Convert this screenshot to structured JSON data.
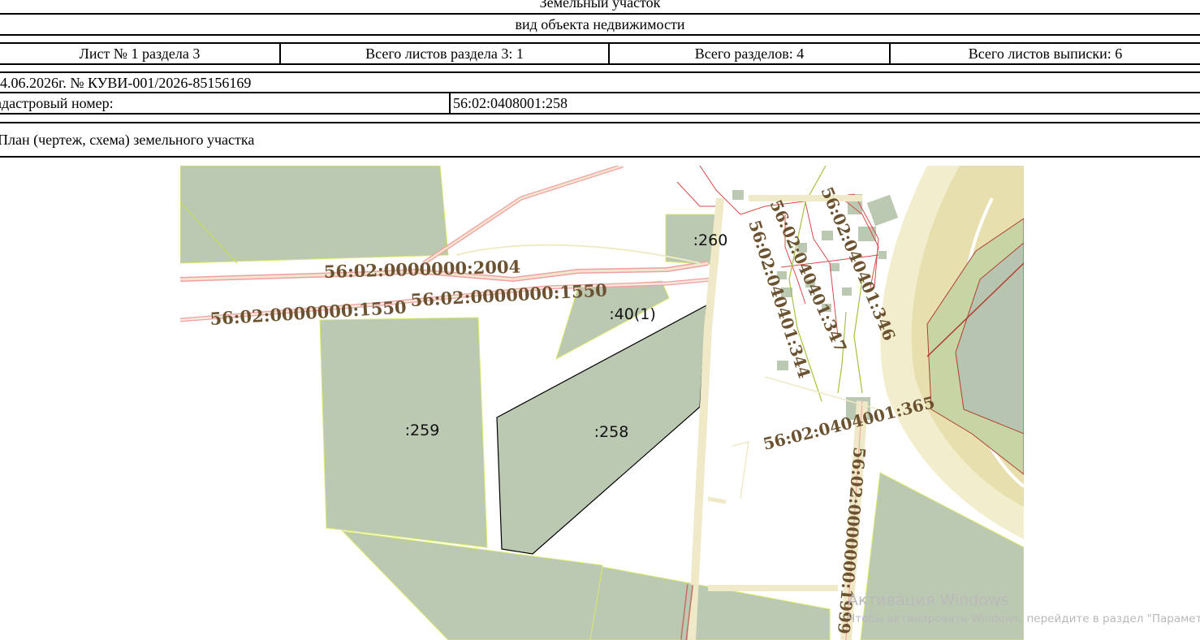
{
  "header": {
    "object_type": "Земельный участок",
    "object_type_caption": "вид объекта недвижимости",
    "sheet": "Лист № 1 раздела 3",
    "sheets_in_section": "Всего листов раздела 3: 1",
    "sections_total": "Всего разделов: 4",
    "sheets_total": "Всего листов выписки: 6",
    "date_number": "4.06.2026г. № КУВИ-001/2026-85156169",
    "cadastral_label": "адастровый номер:",
    "cadastral_value": "56:02:0408001:258",
    "plan_title": "План (чертеж, схема) земельного участка"
  },
  "map": {
    "colors": {
      "parcel_fill": "#bcc9b2",
      "selected_outline": "#000000",
      "road_fill": "#efe9c8",
      "road_outline": "#f0a0a0",
      "label_color": "#6b5230",
      "river_band": "#ece6b8",
      "forest": "#c7d4a4"
    },
    "parcel_labels": [
      ":260",
      ":40(1)",
      ":259",
      ":258"
    ],
    "road_labels": [
      "56:02:0000000:2004",
      "56:02:0000000:1550",
      "56:02:0000000:1550",
      "56:02:040401:347",
      "56:02:040401:344",
      "56:02:040401:346",
      "56:02:0404001:365",
      "56:02:0000000:1999"
    ]
  },
  "watermark": {
    "title": "Активация Windows",
    "subtitle": "Чтобы активировать Windows, перейдите в раздел \"Параметры\"."
  }
}
